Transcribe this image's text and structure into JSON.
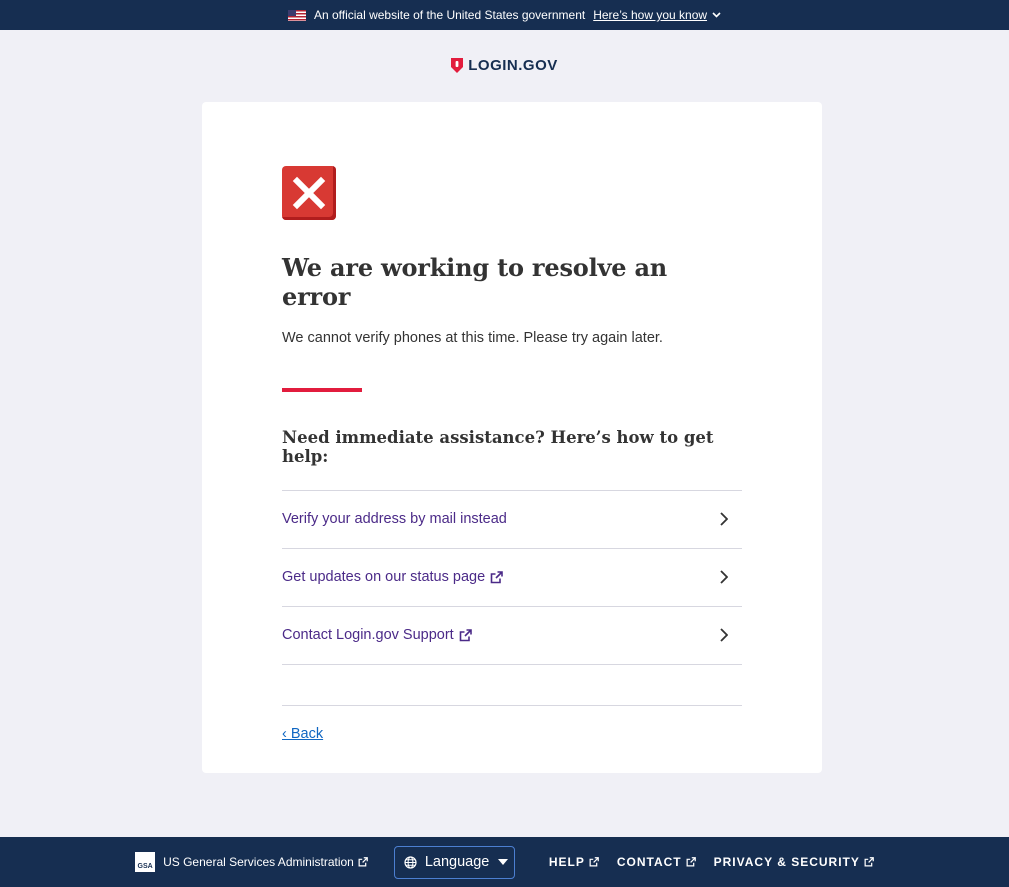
{
  "banner": {
    "official_text": "An official website of the United States government",
    "how_you_know": "Here’s how you know",
    "flag_icon": "us-flag-icon",
    "chevron_icon": "chevron-down-icon"
  },
  "logo": {
    "wordmark": "LOGIN.GOV",
    "icon": "login-shield-icon"
  },
  "card": {
    "status_icon": "error-x-icon",
    "title": "We are working to resolve an error",
    "message": "We cannot verify phones at this time. Please try again later.",
    "help_heading": "Need immediate assistance? Here’s how to get help:",
    "help_items": [
      {
        "label": "Verify your address by mail instead",
        "external": false
      },
      {
        "label": "Get updates on our status page",
        "external": true
      },
      {
        "label": "Contact Login.gov Support",
        "external": true
      }
    ],
    "back_link": "‹ Back"
  },
  "footer": {
    "gsa_logo_text": "GSA",
    "gsa_label": "US General Services Administration",
    "language_button": "Language",
    "links": [
      "HELP",
      "CONTACT",
      "PRIVACY & SECURITY"
    ]
  },
  "colors": {
    "banner_bg": "#162e51",
    "accent_red": "#e21c3d",
    "link_purple": "#4b2a88",
    "link_blue": "#0f66c2",
    "error_red": "#d83933"
  }
}
